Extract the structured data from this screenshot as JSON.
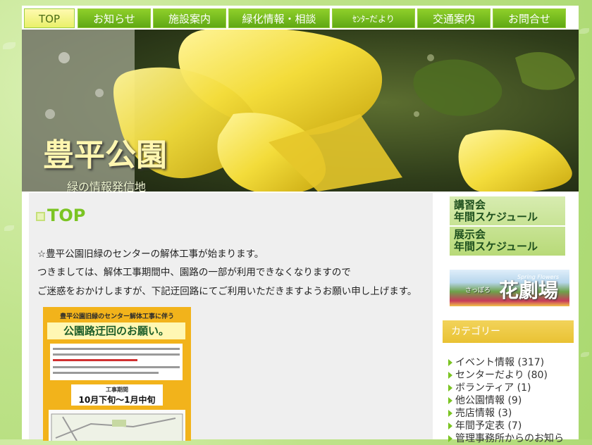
{
  "nav": {
    "items": [
      {
        "label": "TOP"
      },
      {
        "label": "お知らせ"
      },
      {
        "label": "施設案内"
      },
      {
        "label": "緑化情報・相談"
      },
      {
        "label": "ｾﾝﾀｰだより"
      },
      {
        "label": "交通案内"
      },
      {
        "label": "お問合せ"
      }
    ]
  },
  "hero": {
    "title": "豊平公園",
    "subtitle": "緑の情報発信地"
  },
  "main": {
    "heading": "TOP",
    "paragraphs": [
      "☆豊平公園旧緑のセンターの解体工事が始まります。",
      "つきましては、解体工事期間中、園路の一部が利用できなくなりますので",
      "ご迷惑をおかけしますが、下記迂回路にてご利用いただきますようお願い申し上げます。"
    ],
    "notice": {
      "header": "豊平公園旧緑のセンター解体工事に伴う",
      "title": "公園路迂回のお願い。",
      "period_label": "工事期間",
      "period_value": "10月下旬〜1月中旬"
    }
  },
  "sidebar": {
    "banner_schedule": {
      "line1": "講習会",
      "line2": "年間スケジュール",
      "line3": "展示会",
      "line4": "年間スケジュール"
    },
    "banner_flower": {
      "small_text": "さっぽろ",
      "big_text": "花劇場",
      "english": "Spring Flowers"
    },
    "category_title": "カテゴリー",
    "categories": [
      "イベント情報 (317)",
      "センターだより (80)",
      "ボランティア (1)",
      "他公園情報 (9)",
      "売店情報 (3)",
      "年間予定表 (7)",
      "管理事務所からのお知ら"
    ]
  },
  "colors": {
    "accent_green": "#7bc423",
    "nav_active": "#e9f06a",
    "category_header": "#e9c233"
  }
}
